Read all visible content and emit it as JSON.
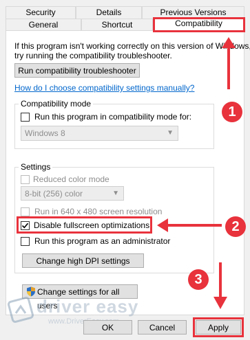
{
  "tabs": {
    "row1": [
      "Security",
      "Details",
      "Previous Versions"
    ],
    "row2": [
      "General",
      "Shortcut",
      "Compatibility"
    ]
  },
  "intro": {
    "text_line1": "If this program isn't working correctly on this version of Windows,",
    "text_line2": "try running the compatibility troubleshooter."
  },
  "troubleshooter_button": "Run compatibility troubleshooter",
  "help_link": "How do I choose compatibility settings manually?",
  "compat_mode": {
    "title": "Compatibility mode",
    "checkbox_label": "Run this program in compatibility mode for:",
    "checked": false,
    "select_value": "Windows 8"
  },
  "settings": {
    "title": "Settings",
    "reduced_color": "Reduced color mode",
    "color_select": "8-bit (256) color",
    "run_640": "Run in 640 x 480 screen resolution",
    "disable_fullscreen": "Disable fullscreen optimizations",
    "disable_fullscreen_checked": true,
    "run_admin": "Run this program as an administrator",
    "dpi_button": "Change high DPI settings"
  },
  "all_users_button": "Change settings for all users",
  "footer": {
    "ok": "OK",
    "cancel": "Cancel",
    "apply": "Apply"
  },
  "annotations": {
    "step1": "1",
    "step2": "2",
    "step3": "3",
    "accent": "#e8323c"
  },
  "watermark": {
    "brand": "driver easy",
    "url": "www.DriverEasy.com"
  }
}
